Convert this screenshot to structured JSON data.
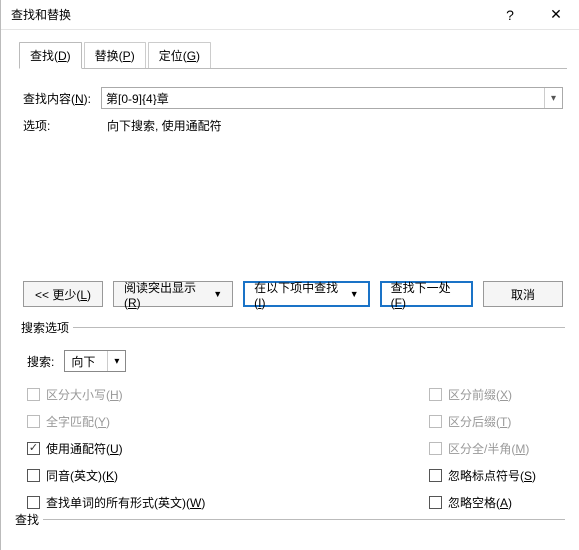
{
  "title": "查找和替换",
  "tabs": [
    {
      "label": "查找(D)",
      "ul": "D",
      "active": true
    },
    {
      "label": "替换(P)",
      "ul": "P",
      "active": false
    },
    {
      "label": "定位(G)",
      "ul": "G",
      "active": false
    }
  ],
  "form": {
    "find_label": "查找内容(N):",
    "find_value": "第[0-9]{4}章",
    "options_label": "选项:",
    "options_value": "向下搜索, 使用通配符"
  },
  "buttons": {
    "less": "<< 更少(L)",
    "reading": "阅读突出显示(R)",
    "findin": "在以下项中查找(I)",
    "findnext": "查找下一处(F)",
    "cancel": "取消"
  },
  "search_options": {
    "legend": "搜索选项",
    "search_label": "搜索:",
    "direction": "向下",
    "checks": {
      "match_case": {
        "label": "区分大小写(H)",
        "checked": false,
        "disabled": true
      },
      "prefix": {
        "label": "区分前缀(X)",
        "checked": false,
        "disabled": true
      },
      "whole_word": {
        "label": "全字匹配(Y)",
        "checked": false,
        "disabled": true
      },
      "suffix": {
        "label": "区分后缀(T)",
        "checked": false,
        "disabled": true
      },
      "wildcards": {
        "label": "使用通配符(U)",
        "checked": true,
        "disabled": false
      },
      "width": {
        "label": "区分全/半角(M)",
        "checked": false,
        "disabled": true
      },
      "sounds": {
        "label": "同音(英文)(K)",
        "checked": false,
        "disabled": false
      },
      "punct": {
        "label": "忽略标点符号(S)",
        "checked": false,
        "disabled": false
      },
      "wordforms": {
        "label": "查找单词的所有形式(英文)(W)",
        "checked": false,
        "disabled": false
      },
      "whitespace": {
        "label": "忽略空格(A)",
        "checked": false,
        "disabled": false
      }
    }
  },
  "find_section": {
    "legend": "查找"
  }
}
